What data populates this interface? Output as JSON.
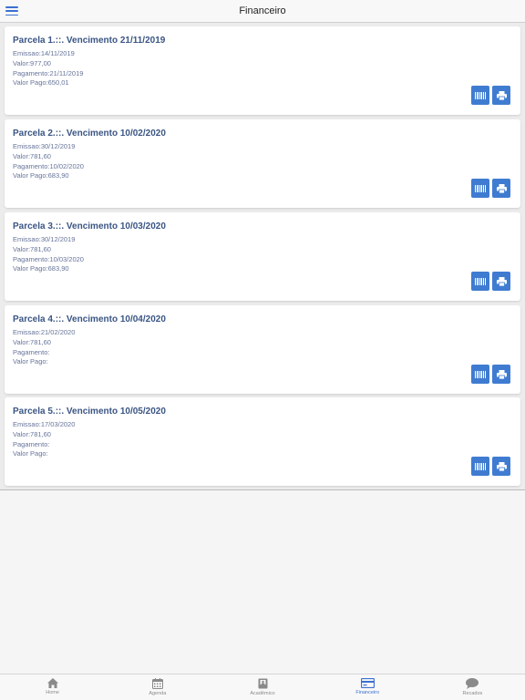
{
  "header": {
    "title": "Financeiro",
    "menu_icon": "hamburger-icon"
  },
  "parcelas": [
    {
      "title": "Parcela 1.::. Vencimento 21/11/2019",
      "emissao": "Emissao:14/11/2019",
      "valor": "Valor:977,00",
      "pagamento": "Pagamento:21/11/2019",
      "valor_pago": "Valor Pago:650,01"
    },
    {
      "title": "Parcela 2.::. Vencimento 10/02/2020",
      "emissao": "Emissao:30/12/2019",
      "valor": "Valor:781,60",
      "pagamento": "Pagamento:10/02/2020",
      "valor_pago": "Valor Pago:683,90"
    },
    {
      "title": "Parcela 3.::. Vencimento 10/03/2020",
      "emissao": "Emissao:30/12/2019",
      "valor": "Valor:781,60",
      "pagamento": "Pagamento:10/03/2020",
      "valor_pago": "Valor Pago:683,90"
    },
    {
      "title": "Parcela 4.::. Vencimento 10/04/2020",
      "emissao": "Emissao:21/02/2020",
      "valor": "Valor:781,60",
      "pagamento": "Pagamento:",
      "valor_pago": "Valor Pago:"
    },
    {
      "title": "Parcela 5.::. Vencimento 10/05/2020",
      "emissao": "Emissao:17/03/2020",
      "valor": "Valor:781,60",
      "pagamento": "Pagamento:",
      "valor_pago": "Valor Pago:"
    }
  ],
  "card_buttons": {
    "barcode_icon": "barcode-icon",
    "print_icon": "printer-icon"
  },
  "tabs": [
    {
      "label": "Home",
      "icon": "home-icon",
      "active": false
    },
    {
      "label": "Agenda",
      "icon": "calendar-icon",
      "active": false
    },
    {
      "label": "Acadêmico",
      "icon": "book-icon",
      "active": false
    },
    {
      "label": "Financeiro",
      "icon": "card-icon",
      "active": true
    },
    {
      "label": "Recados",
      "icon": "chat-bubble-icon",
      "active": false
    }
  ],
  "colors": {
    "accent": "#3f7cd1",
    "title_text": "#3a5584",
    "body_text": "#66749a",
    "tab_inactive": "#8a8a8a"
  }
}
